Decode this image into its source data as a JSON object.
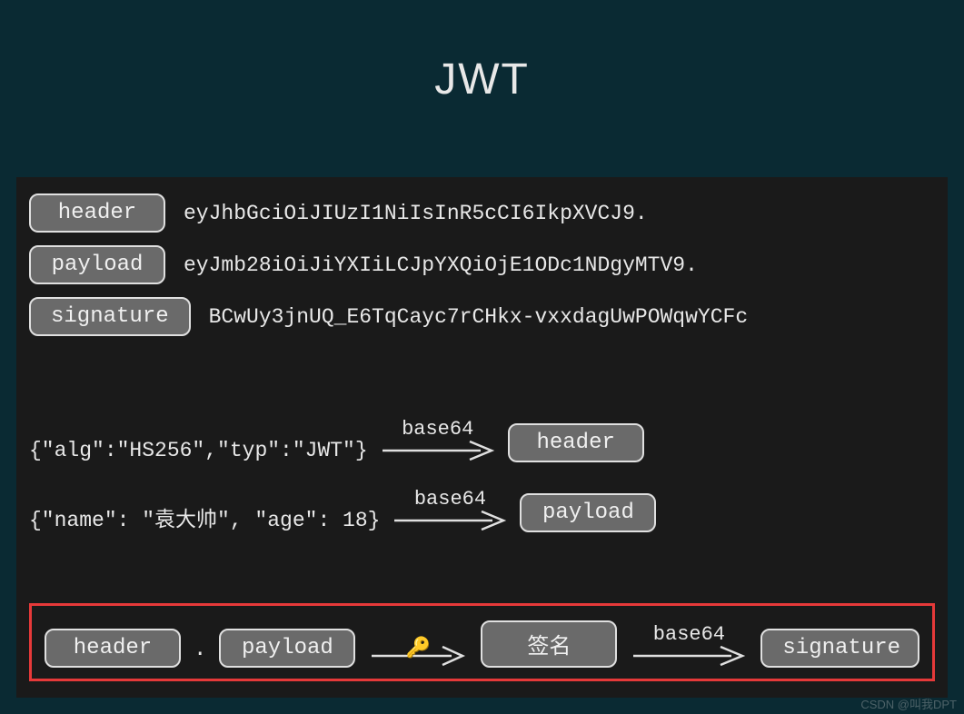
{
  "title": "JWT",
  "parts": {
    "header": {
      "label": "header",
      "encoded": "eyJhbGciOiJIUzI1NiIsInR5cCI6IkpXVCJ9."
    },
    "payload": {
      "label": "payload",
      "encoded": "eyJmb28iOiJiYXIiLCJpYXQiOjE1ODc1NDgyMTV9."
    },
    "signature": {
      "label": "signature",
      "encoded": "BCwUy3jnUQ_E6TqCayc7rCHkx-vxxdagUwPOWqwYCFc"
    }
  },
  "decode": {
    "header_json": "{\"alg\":\"HS256\",\"typ\":\"JWT\"}",
    "payload_json": "{\"name\": \"袁大帅\", \"age\": 18}",
    "arrow_label": "base64"
  },
  "signing": {
    "header_label": "header",
    "payload_label": "payload",
    "sign_label": "签名",
    "signature_label": "signature",
    "arrow_label": "base64",
    "key_icon": "🔑",
    "separator": "."
  },
  "watermark": "CSDN @叫我DPT"
}
